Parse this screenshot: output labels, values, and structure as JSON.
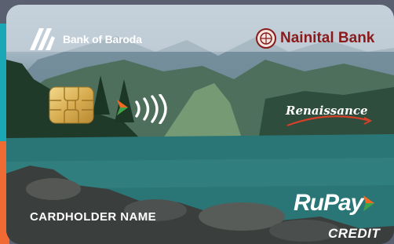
{
  "issuer": {
    "primary_bank": "Bank of Baroda",
    "partner_bank": "Nainital Bank"
  },
  "card": {
    "variant": "Renaissance",
    "network": "RuPay",
    "type": "CREDIT",
    "cardholder_placeholder": "CARDHOLDER NAME"
  },
  "icons": {
    "bob": "bank-of-baroda-logo",
    "partner": "nainital-bank-emblem",
    "chip": "emv-chip-icon",
    "contactless": "contactless-icon",
    "network_mark": "rupay-triangle-icon"
  },
  "colors": {
    "teal_stripe": "#1aa7b6",
    "orange_stripe": "#f06a33",
    "partner_red": "#8a1b1b",
    "rupay_orange": "#f26a21",
    "rupay_green": "#3aa54a"
  }
}
